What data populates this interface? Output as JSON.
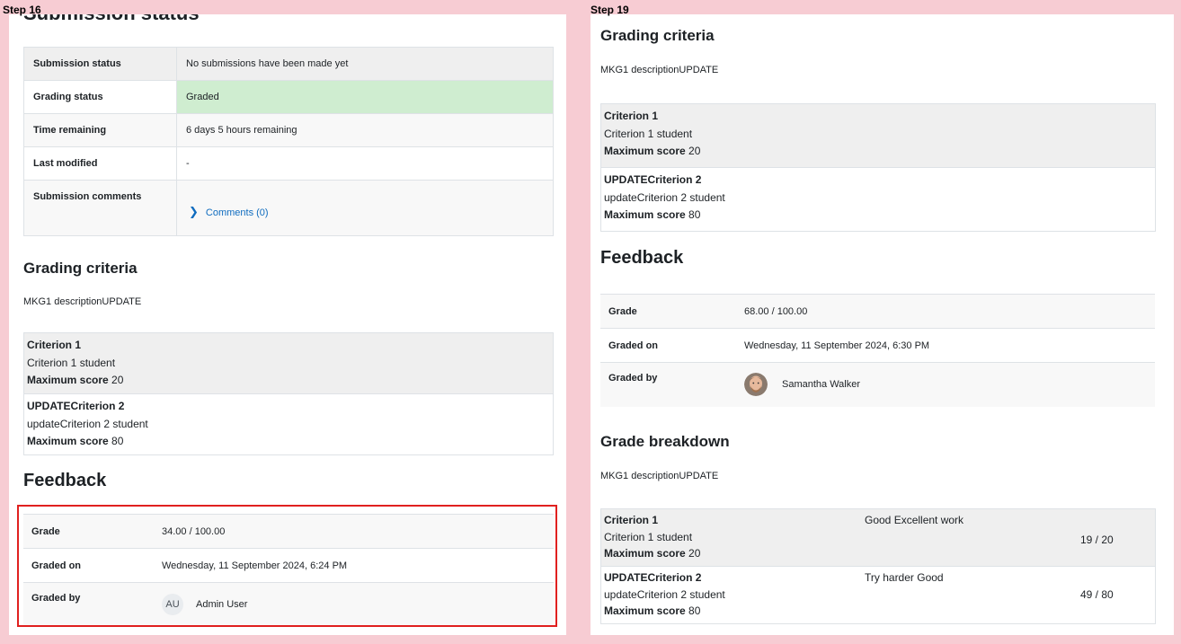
{
  "steps": {
    "left": "Step 16",
    "right": "Step 19"
  },
  "left": {
    "cut_heading": "Submission status",
    "status_rows": [
      {
        "label": "Submission status",
        "value": "No submissions have been made yet"
      },
      {
        "label": "Grading status",
        "value": "Graded"
      },
      {
        "label": "Time remaining",
        "value": "6 days 5 hours remaining"
      },
      {
        "label": "Last modified",
        "value": "-"
      },
      {
        "label": "Submission comments",
        "value": "Comments (0)"
      }
    ],
    "grading_criteria_heading": "Grading criteria",
    "grading_criteria_desc": "MKG1 descriptionUPDATE",
    "criteria": [
      {
        "title": "Criterion 1",
        "desc": "Criterion 1 student",
        "max_label": "Maximum score",
        "max_value": "20"
      },
      {
        "title": "UPDATECriterion 2",
        "desc": "updateCriterion 2 student",
        "max_label": "Maximum score",
        "max_value": "80"
      }
    ],
    "feedback_heading": "Feedback",
    "feedback": {
      "grade_label": "Grade",
      "grade_value": "34.00 / 100.00",
      "graded_on_label": "Graded on",
      "graded_on_value": "Wednesday, 11 September 2024, 6:24 PM",
      "graded_by_label": "Graded by",
      "grader_initials": "AU",
      "grader_name": "Admin User"
    }
  },
  "right": {
    "grading_criteria_heading": "Grading criteria",
    "grading_criteria_desc": "MKG1 descriptionUPDATE",
    "criteria": [
      {
        "title": "Criterion 1",
        "desc": "Criterion 1 student",
        "max_label": "Maximum score",
        "max_value": "20"
      },
      {
        "title": "UPDATECriterion 2",
        "desc": "updateCriterion 2 student",
        "max_label": "Maximum score",
        "max_value": "80"
      }
    ],
    "feedback_heading": "Feedback",
    "feedback": {
      "grade_label": "Grade",
      "grade_value": "68.00 / 100.00",
      "graded_on_label": "Graded on",
      "graded_on_value": "Wednesday, 11 September 2024, 6:30 PM",
      "graded_by_label": "Graded by",
      "grader_name": "Samantha Walker"
    },
    "breakdown_heading": "Grade breakdown",
    "breakdown_desc": "MKG1 descriptionUPDATE",
    "breakdown": [
      {
        "title": "Criterion 1",
        "desc": "Criterion 1 student",
        "max_label": "Maximum score",
        "max_value": "20",
        "remark": "Good Excellent work",
        "score": "19 / 20"
      },
      {
        "title": "UPDATECriterion 2",
        "desc": "updateCriterion 2 student",
        "max_label": "Maximum score",
        "max_value": "80",
        "remark": "Try harder Good",
        "score": "49 / 80"
      }
    ]
  },
  "colors": {
    "highlight": "#e0201f",
    "graded_bg": "#cfedd0",
    "page_bg": "#f7ccd3",
    "link": "#0f6cbf"
  }
}
